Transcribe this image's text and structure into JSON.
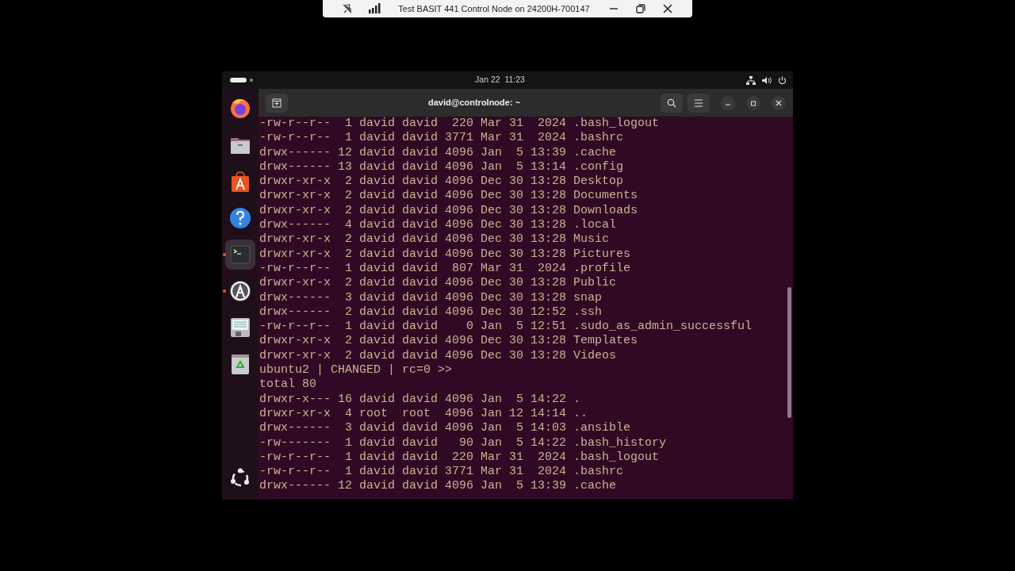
{
  "remote_bar": {
    "title": "Test BASIT 441 Control Node on 24200H-700147"
  },
  "top_bar": {
    "clock": "Jan 22  11:23"
  },
  "dock": [
    {
      "kind": "firefox",
      "running": false,
      "selected": false
    },
    {
      "kind": "files",
      "running": false,
      "selected": false
    },
    {
      "kind": "store",
      "running": false,
      "selected": false
    },
    {
      "kind": "help",
      "running": false,
      "selected": false
    },
    {
      "kind": "terminal",
      "running": true,
      "selected": true
    },
    {
      "kind": "updater",
      "running": true,
      "selected": false
    },
    {
      "kind": "disk",
      "running": false,
      "selected": false
    },
    {
      "kind": "trash",
      "running": false,
      "selected": false
    }
  ],
  "terminal": {
    "title": "david@controlnode: ~",
    "lines": [
      "-rw-r--r--  1 david david  220 Mar 31  2024 .bash_logout",
      "-rw-r--r--  1 david david 3771 Mar 31  2024 .bashrc",
      "drwx------ 12 david david 4096 Jan  5 13:39 .cache",
      "drwx------ 13 david david 4096 Jan  5 13:14 .config",
      "drwxr-xr-x  2 david david 4096 Dec 30 13:28 Desktop",
      "drwxr-xr-x  2 david david 4096 Dec 30 13:28 Documents",
      "drwxr-xr-x  2 david david 4096 Dec 30 13:28 Downloads",
      "drwx------  4 david david 4096 Dec 30 13:28 .local",
      "drwxr-xr-x  2 david david 4096 Dec 30 13:28 Music",
      "drwxr-xr-x  2 david david 4096 Dec 30 13:28 Pictures",
      "-rw-r--r--  1 david david  807 Mar 31  2024 .profile",
      "drwxr-xr-x  2 david david 4096 Dec 30 13:28 Public",
      "drwx------  3 david david 4096 Dec 30 13:28 snap",
      "drwx------  2 david david 4096 Dec 30 12:52 .ssh",
      "-rw-r--r--  1 david david    0 Jan  5 12:51 .sudo_as_admin_successful",
      "drwxr-xr-x  2 david david 4096 Dec 30 13:28 Templates",
      "drwxr-xr-x  2 david david 4096 Dec 30 13:28 Videos",
      "ubuntu2 | CHANGED | rc=0 >>",
      "total 80",
      "drwxr-x--- 16 david david 4096 Jan  5 14:22 .",
      "drwxr-xr-x  4 root  root  4096 Jan 12 14:14 ..",
      "drwx------  3 david david 4096 Jan  5 14:03 .ansible",
      "-rw-------  1 david david   90 Jan  5 14:22 .bash_history",
      "-rw-r--r--  1 david david  220 Mar 31  2024 .bash_logout",
      "-rw-r--r--  1 david david 3771 Mar 31  2024 .bashrc",
      "drwx------ 12 david david 4096 Jan  5 13:39 .cache"
    ]
  }
}
